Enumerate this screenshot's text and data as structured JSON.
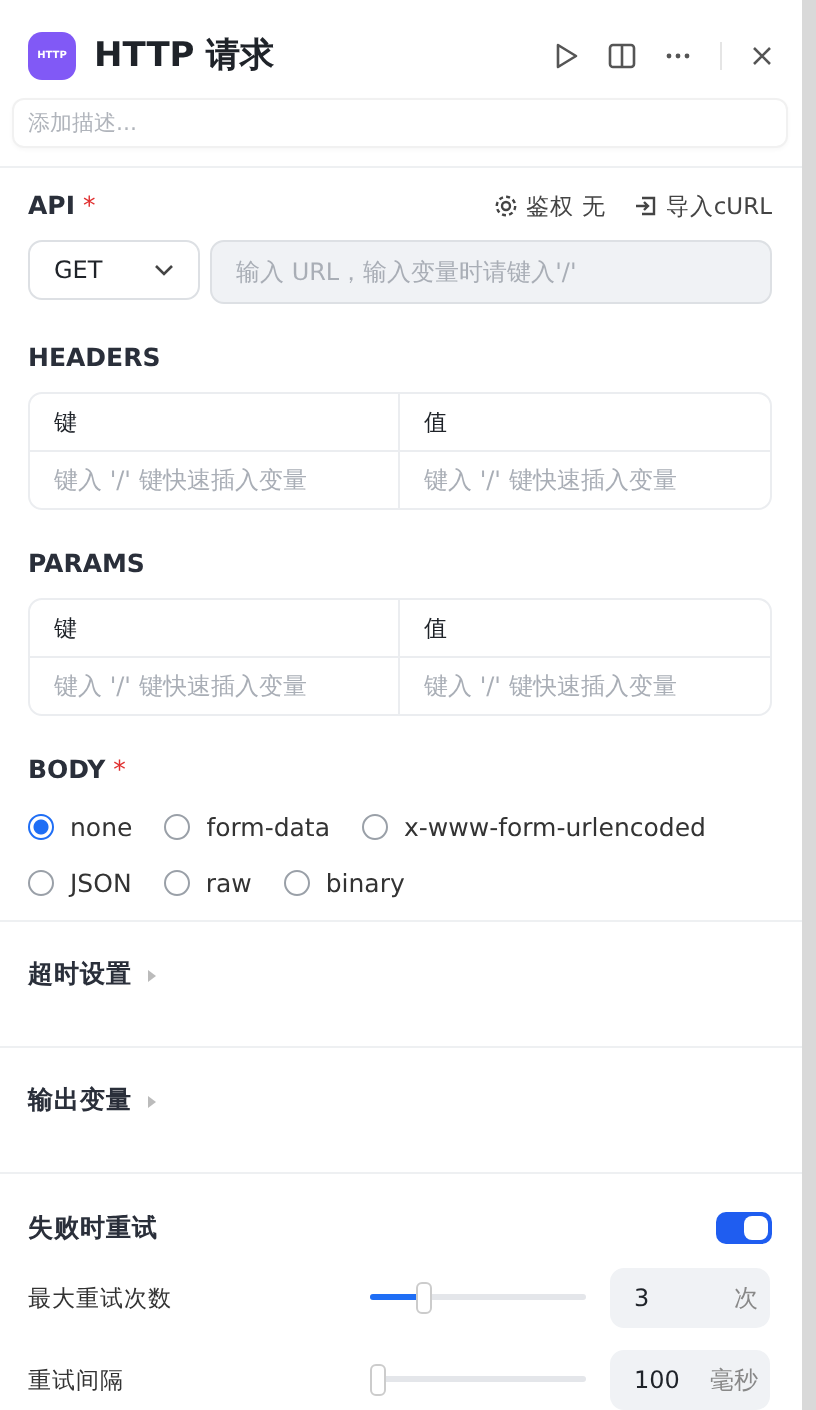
{
  "header": {
    "logo_text": "HTTP",
    "title": "HTTP 请求",
    "description_placeholder": "添加描述..."
  },
  "api": {
    "label": "API",
    "required_mark": "*",
    "auth_label": "鉴权",
    "auth_value": "无",
    "import_label": "导入cURL",
    "method": "GET",
    "url_placeholder": "输入 URL，输入变量时请键入'/'"
  },
  "tables": [
    {
      "title": "HEADERS",
      "columns": [
        "键",
        "值"
      ],
      "placeholders": [
        "键入 '/' 键快速插入变量",
        "键入 '/' 键快速插入变量"
      ]
    },
    {
      "title": "PARAMS",
      "columns": [
        "键",
        "值"
      ],
      "placeholders": [
        "键入 '/' 键快速插入变量",
        "键入 '/' 键快速插入变量"
      ]
    }
  ],
  "body": {
    "label": "BODY",
    "required_mark": "*",
    "options": [
      {
        "label": "none",
        "selected": true
      },
      {
        "label": "form-data",
        "selected": false
      },
      {
        "label": "x-www-form-urlencoded",
        "selected": false
      },
      {
        "label": "JSON",
        "selected": false
      },
      {
        "label": "raw",
        "selected": false
      },
      {
        "label": "binary",
        "selected": false
      }
    ]
  },
  "sections": [
    {
      "title": "超时设置",
      "expanded": false
    },
    {
      "title": "输出变量",
      "expanded": false
    }
  ],
  "retry": {
    "title": "失败时重试",
    "on": true,
    "rows": [
      {
        "label": "最大重试次数",
        "level": 0.23,
        "value": "3",
        "unit": "次"
      },
      {
        "label": "重试间隔",
        "level": 0,
        "value": "100",
        "unit": "毫秒"
      }
    ]
  }
}
